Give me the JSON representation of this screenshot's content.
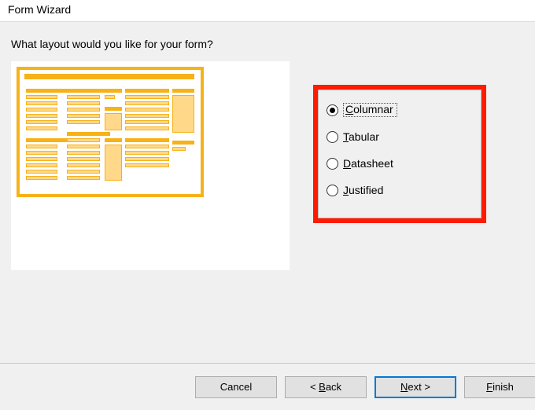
{
  "title": "Form Wizard",
  "prompt": "What layout would you like for your form?",
  "options": {
    "columnar": {
      "pre": "",
      "accel": "C",
      "rest": "olumnar"
    },
    "tabular": {
      "pre": "",
      "accel": "T",
      "rest": "abular"
    },
    "datasheet": {
      "pre": "",
      "accel": "D",
      "rest": "atasheet"
    },
    "justified": {
      "pre": "",
      "accel": "J",
      "rest": "ustified"
    }
  },
  "selected": "columnar",
  "buttons": {
    "cancel": "Cancel",
    "back": {
      "pre": "< ",
      "accel": "B",
      "rest": "ack"
    },
    "next": {
      "pre": "",
      "accel": "N",
      "rest": "ext >"
    },
    "finish": {
      "pre": "",
      "accel": "F",
      "rest": "inish"
    }
  }
}
